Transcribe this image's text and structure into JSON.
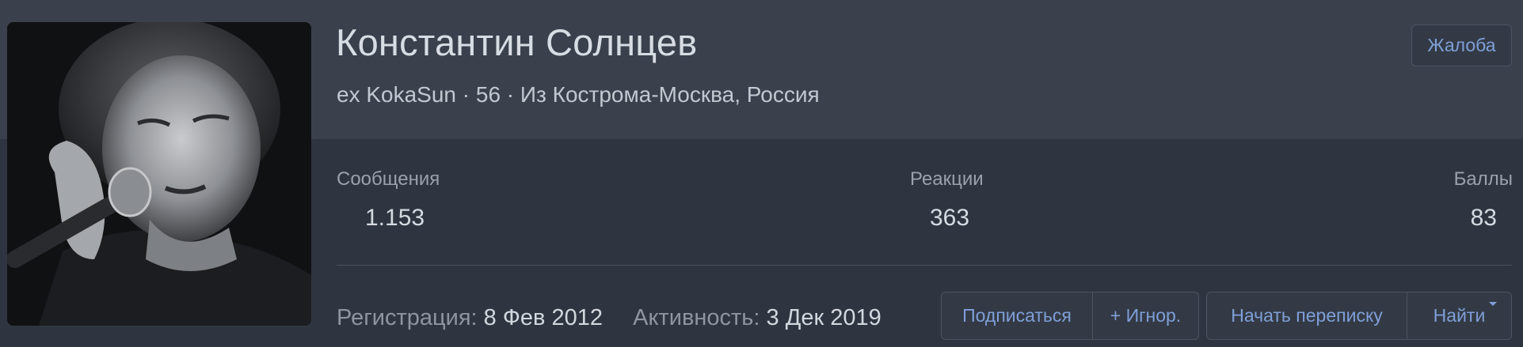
{
  "profile": {
    "name": "Константин Солнцев",
    "blurb": "ex KokaSun · 56 · Из Кострома-Москва, Россия",
    "report_label": "Жалоба"
  },
  "stats": {
    "messages": {
      "label": "Сообщения",
      "value": "1.153"
    },
    "reactions": {
      "label": "Реакции",
      "value": "363"
    },
    "points": {
      "label": "Баллы",
      "value": "83"
    }
  },
  "meta": {
    "registration_label": "Регистрация:",
    "registration_value": "8 Фев 2012",
    "activity_label": "Активность:",
    "activity_value": "3 Дек 2019"
  },
  "actions": {
    "follow_label": "Подписаться",
    "ignore_label": "+ Игнор.",
    "start_conversation_label": "Начать переписку",
    "find_label": "Найти"
  },
  "colors": {
    "header_bg": "#3a414d",
    "content_bg": "#2f3540",
    "link_accent": "#7f9fd8"
  },
  "icons": {
    "find_dropdown": "chevron-down-icon"
  }
}
